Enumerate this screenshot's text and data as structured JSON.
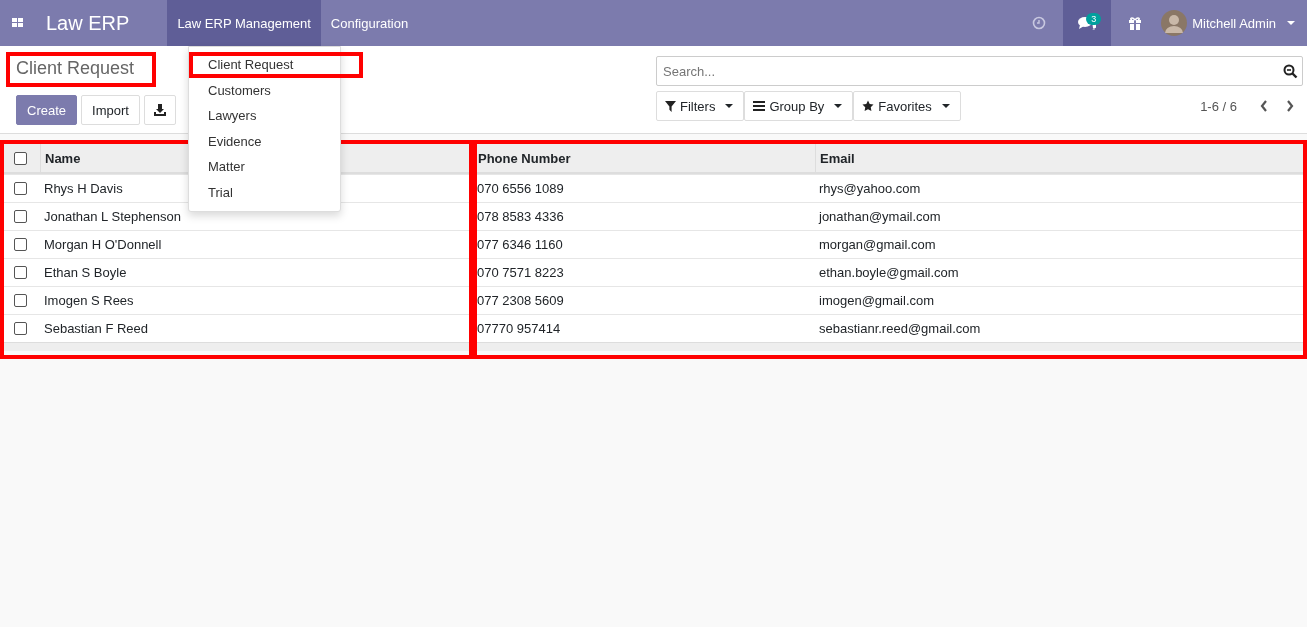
{
  "navbar": {
    "app_name": "Law ERP",
    "menus": [
      {
        "label": "Law ERP Management",
        "open": true
      },
      {
        "label": "Configuration",
        "open": false
      }
    ],
    "message_count": "3",
    "user": "Mitchell Admin"
  },
  "dropdown": {
    "items": [
      {
        "label": "Client Request",
        "highlighted": true
      },
      {
        "label": "Customers",
        "highlighted": false
      },
      {
        "label": "Lawyers",
        "highlighted": false
      },
      {
        "label": "Evidence",
        "highlighted": false
      },
      {
        "label": "Matter",
        "highlighted": false
      },
      {
        "label": "Trial",
        "highlighted": false
      }
    ]
  },
  "page": {
    "title": "Client Request",
    "title_highlighted": true,
    "buttons": [
      {
        "label": "Create",
        "kind": "primary"
      },
      {
        "label": "Import",
        "kind": "secondary"
      }
    ]
  },
  "search": {
    "placeholder": "Search..."
  },
  "search_options": [
    {
      "label": "Filters",
      "kind": "filter"
    },
    {
      "label": "Group By",
      "kind": "group"
    },
    {
      "label": "Favorites",
      "kind": "star"
    }
  ],
  "pager": "1-6 / 6",
  "table": {
    "all_checked": false,
    "columns": [
      {
        "label": "Name",
        "highlighted": true,
        "frame_ends": true
      },
      {
        "label": "Phone Number",
        "highlighted": true,
        "frame_ends": false
      },
      {
        "label": "Email",
        "highlighted": true,
        "frame_ends": true
      }
    ],
    "rows": [
      {
        "checked": false,
        "cells": [
          "Rhys H Davis",
          "070 6556 1089",
          "rhys@yahoo.com"
        ]
      },
      {
        "checked": false,
        "cells": [
          "Jonathan L Stephenson",
          "078 8583 4336",
          "jonathan@ymail.com"
        ]
      },
      {
        "checked": false,
        "cells": [
          "Morgan H O'Donnell",
          "077 6346 1160",
          "morgan@gmail.com"
        ]
      },
      {
        "checked": false,
        "cells": [
          "Ethan S Boyle",
          "070 7571 8223",
          "ethan.boyle@gmail.com"
        ]
      },
      {
        "checked": false,
        "cells": [
          "Imogen S Rees",
          "077 2308 5609",
          "imogen@gmail.com"
        ]
      },
      {
        "checked": false,
        "cells": [
          "Sebastian F Reed",
          "07770 957414",
          "sebastianr.reed@gmail.com"
        ]
      }
    ]
  }
}
